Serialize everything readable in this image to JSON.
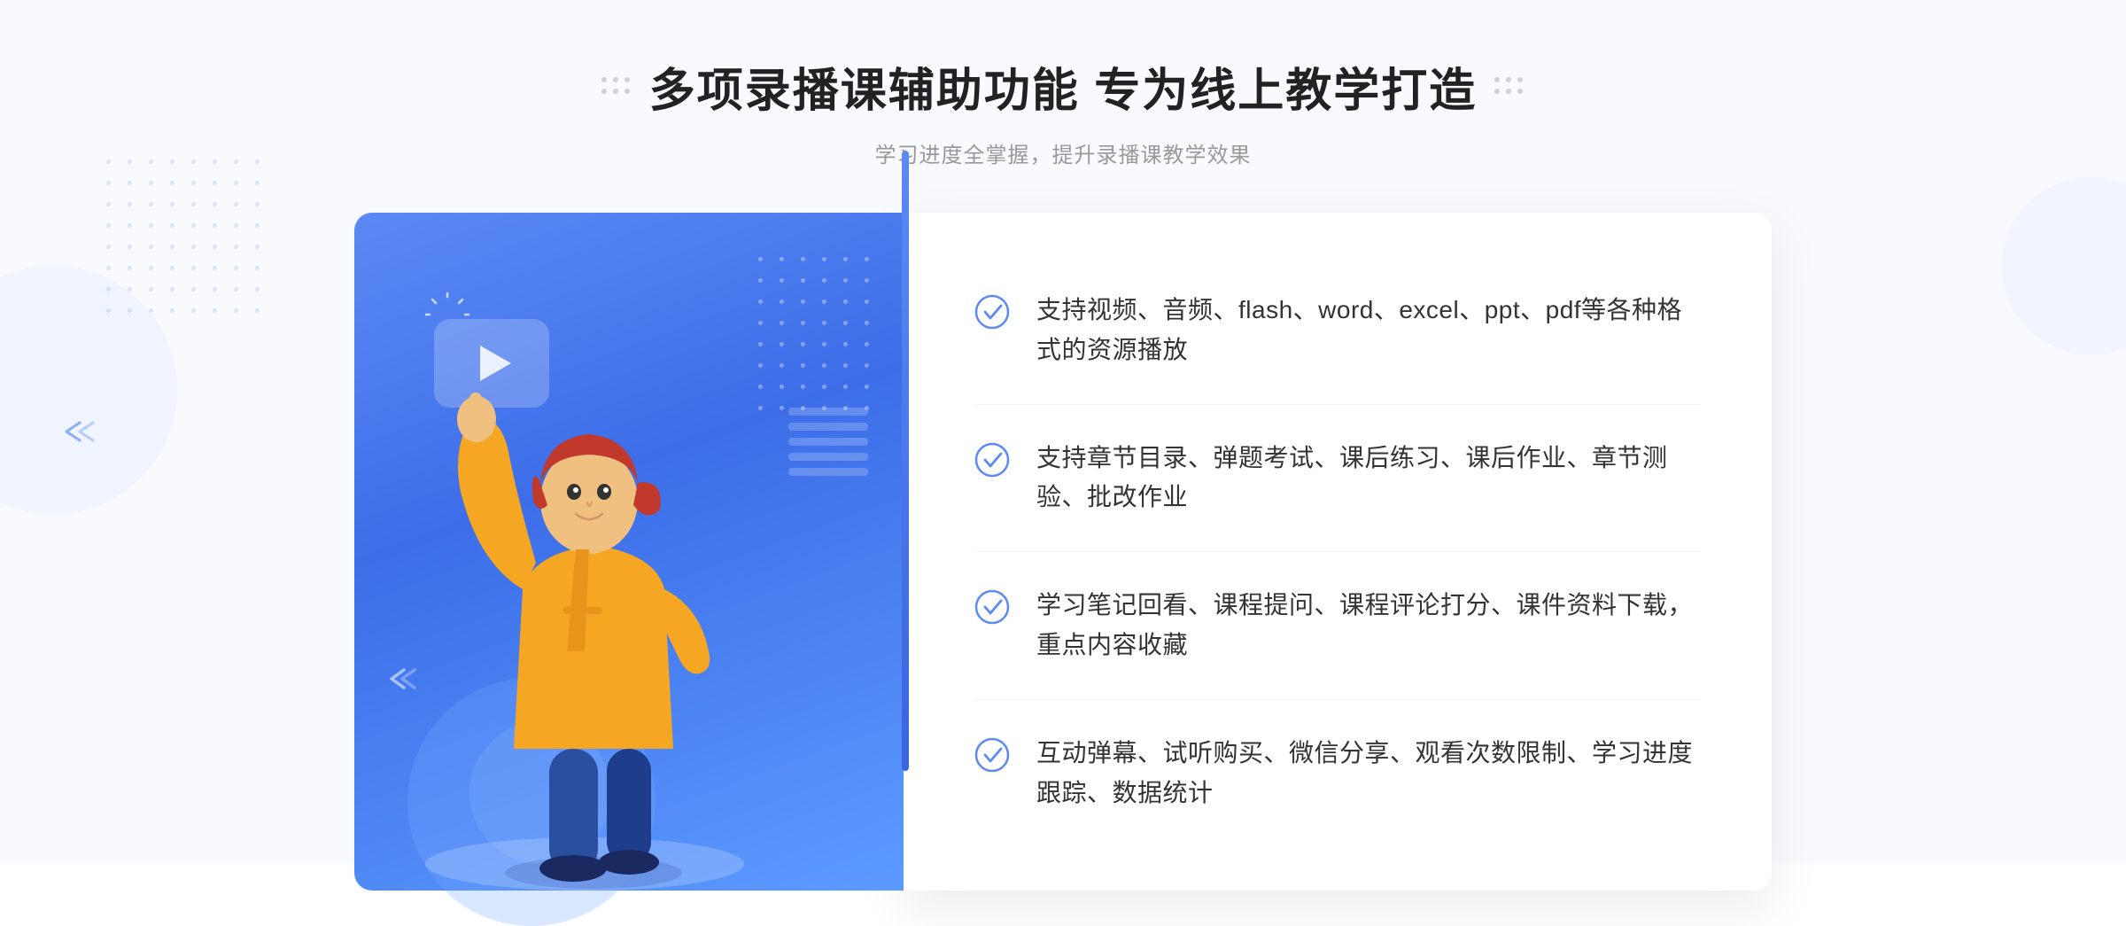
{
  "page": {
    "background": "#f8faff"
  },
  "header": {
    "title": "多项录播课辅助功能 专为线上教学打造",
    "subtitle": "学习进度全掌握，提升录播课教学效果",
    "left_dots": "decorative",
    "right_dots": "decorative"
  },
  "features": [
    {
      "id": 1,
      "text": "支持视频、音频、flash、word、excel、ppt、pdf等各种格式的资源播放"
    },
    {
      "id": 2,
      "text": "支持章节目录、弹题考试、课后练习、课后作业、章节测验、批改作业"
    },
    {
      "id": 3,
      "text": "学习笔记回看、课程提问、课程评论打分、课件资料下载，重点内容收藏"
    },
    {
      "id": 4,
      "text": "互动弹幕、试听购买、微信分享、观看次数限制、学习进度跟踪、数据统计"
    }
  ],
  "icons": {
    "check": "check-circle-icon",
    "play": "play-icon",
    "chevron_left_page": "chevron-left-page-icon",
    "chevron_left_illus": "chevron-left-illus-icon"
  },
  "colors": {
    "accent_blue": "#4a7ef0",
    "gradient_start": "#5b8af5",
    "gradient_end": "#3d6ee8",
    "text_primary": "#222222",
    "text_secondary": "#999999",
    "text_feature": "#333333",
    "check_color": "#5b8af5"
  }
}
